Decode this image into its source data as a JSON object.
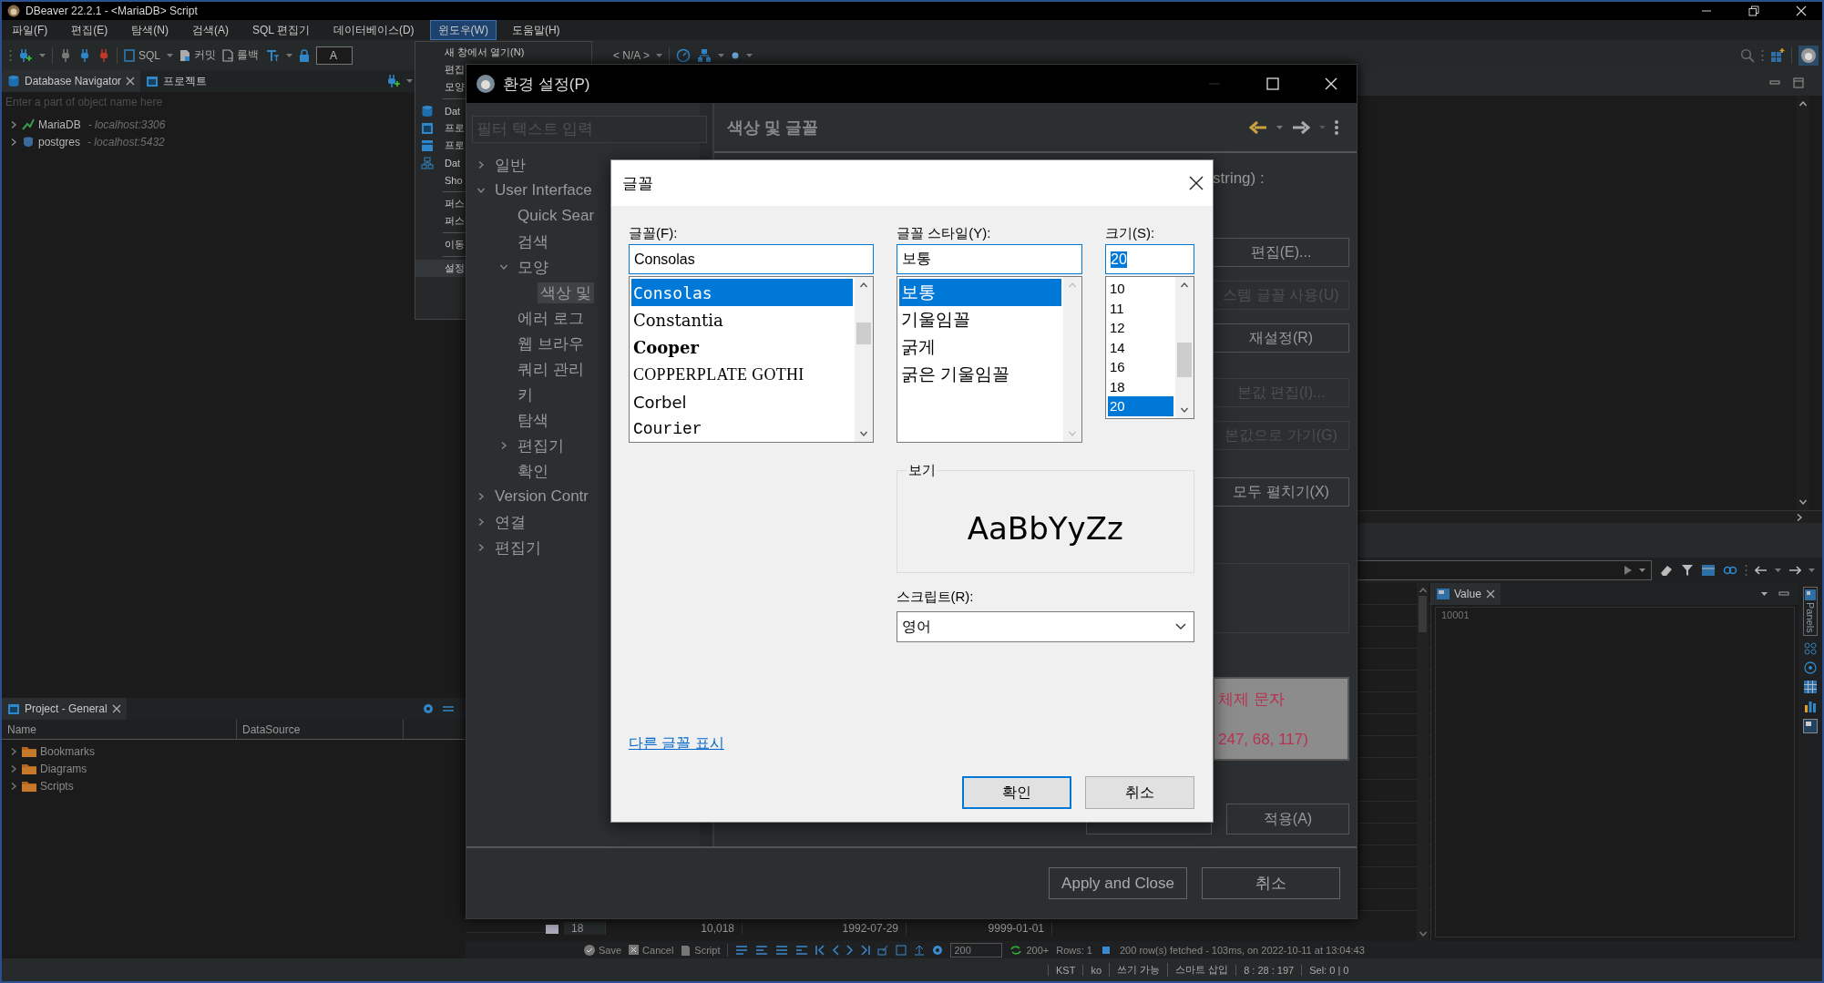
{
  "window": {
    "title": "DBeaver 22.2.1 - <MariaDB> Script"
  },
  "menu_bar": [
    {
      "label": "파일(F)",
      "selected": false
    },
    {
      "label": "편집(E)",
      "selected": false
    },
    {
      "label": "탐색(N)",
      "selected": false
    },
    {
      "label": "검색(A)",
      "selected": false
    },
    {
      "label": "SQL 편집기",
      "selected": false
    },
    {
      "label": "데이터베이스(D)",
      "selected": false
    },
    {
      "label": "윈도우(W)",
      "selected": true
    },
    {
      "label": "도움말(H)",
      "selected": false
    }
  ],
  "toolbar": {
    "sql_label": "SQL",
    "commit_label": "커밋",
    "rollback_label": "롤백",
    "field_value": "A",
    "datasource": "< N/A >"
  },
  "window_menu": {
    "groups": [
      [
        {
          "label": "새 창에서 열기(N)",
          "icon": false,
          "selected": false
        },
        {
          "label": "편집",
          "icon": false,
          "selected": false
        },
        {
          "label": "모양",
          "icon": false,
          "selected": false
        }
      ],
      [
        {
          "label": "Dat",
          "icon": true,
          "selected": false
        },
        {
          "label": "프로",
          "icon": true,
          "selected": false
        },
        {
          "label": "프로",
          "icon": true,
          "selected": false
        },
        {
          "label": "Dat",
          "icon": true,
          "selected": false
        },
        {
          "label": "Sho",
          "icon": false,
          "selected": false
        }
      ],
      [
        {
          "label": "퍼스",
          "icon": false,
          "selected": false
        },
        {
          "label": "퍼스",
          "icon": false,
          "selected": false
        }
      ],
      [
        {
          "label": "이동",
          "icon": false,
          "selected": false
        }
      ],
      [
        {
          "label": "설정",
          "icon": false,
          "selected": true
        }
      ]
    ]
  },
  "navigator": {
    "tabs": [
      {
        "label": "Database Navigator",
        "selected": true
      },
      {
        "label": "프로젝트",
        "selected": false
      }
    ],
    "filter_placeholder": "Enter a part of object name here",
    "connections": [
      {
        "name": "MariaDB",
        "host": "- localhost:3306"
      },
      {
        "name": "postgres",
        "host": "- localhost:5432"
      }
    ]
  },
  "project_panel": {
    "title": "Project - General",
    "columns": [
      "Name",
      "DataSource"
    ],
    "items": [
      "Bookmarks",
      "Diagrams",
      "Scripts"
    ]
  },
  "results": {
    "row": [
      "18",
      "10,018",
      "1992-07-29",
      "9999-01-01"
    ],
    "actions": [
      "Save",
      "Cancel",
      "Script"
    ],
    "fetch_size": "200",
    "more": "200+",
    "rows": "Rows: 1",
    "message": "200 row(s) fetched - 103ms, on 2022-10-11 at 13:04:43"
  },
  "value_panel": {
    "title": "Value",
    "value": "10001"
  },
  "panels_rail": {
    "label": "Panels"
  },
  "status_bar": [
    "KST",
    "ko",
    "쓰기 가능",
    "스마트 삽입",
    "8 : 28 : 197",
    "Sel: 0 | 0"
  ],
  "preferences": {
    "title": "환경 설정(P)",
    "filter_placeholder": "필터 텍스트 입력",
    "tree": [
      {
        "label": "일반",
        "kind": "branch",
        "expanded": false,
        "selected": false
      },
      {
        "label": "User Interface",
        "kind": "branch",
        "expanded": true,
        "selected": false,
        "children": [
          {
            "label": "Quick Sear",
            "kind": "leaf",
            "selected": false
          },
          {
            "label": "검색",
            "kind": "leaf",
            "selected": false
          },
          {
            "label": "모양",
            "kind": "branch",
            "expanded": true,
            "selected": false,
            "children": [
              {
                "label": "색상 및",
                "kind": "leaf",
                "selected": true
              }
            ]
          },
          {
            "label": "에러 로그",
            "kind": "leaf",
            "selected": false
          },
          {
            "label": "웹 브라우",
            "kind": "leaf",
            "selected": false
          },
          {
            "label": "쿼리 관리",
            "kind": "leaf",
            "selected": false
          },
          {
            "label": "키",
            "kind": "leaf",
            "selected": false
          },
          {
            "label": "탐색",
            "kind": "leaf",
            "selected": false
          },
          {
            "label": "편집기",
            "kind": "branch",
            "expanded": false,
            "selected": false
          },
          {
            "label": "확인",
            "kind": "leaf",
            "selected": false
          }
        ]
      },
      {
        "label": "Version Contr",
        "kind": "branch",
        "expanded": false,
        "selected": false
      },
      {
        "label": "연결",
        "kind": "branch",
        "expanded": false,
        "selected": false
      },
      {
        "label": "편집기",
        "kind": "branch",
        "expanded": false,
        "selected": false
      }
    ],
    "page_title": "색상 및 글꼴",
    "page_text": "string) :",
    "side_buttons": [
      {
        "label": "편집(E)...",
        "disabled": false
      },
      {
        "label": "스템 글꼴 사용(U)",
        "disabled": true
      },
      {
        "label": "재설정(R)",
        "disabled": false
      },
      {
        "label": "본값 편집(I)...",
        "disabled": true
      },
      {
        "label": "본값으로 가기(G)",
        "disabled": true
      },
      {
        "label": "모두 펼치기(X)",
        "disabled": false
      }
    ],
    "preview_lines": [
      "체제 문자",
      "247, 68, 117)"
    ],
    "apply_button": "적용(A)",
    "footer_buttons": [
      "Apply and Close",
      "취소"
    ]
  },
  "font_dialog": {
    "title": "글꼴",
    "font": {
      "label": "글꼴(F):",
      "value": "Consolas",
      "options": [
        {
          "label": "Consolas",
          "kind": "mono",
          "selected": true
        },
        {
          "label": "Constantia",
          "kind": "serif",
          "selected": false
        },
        {
          "label": "Cooper",
          "kind": "bold",
          "selected": false
        },
        {
          "label": "COPPERPLATE GOTHI",
          "kind": "wide",
          "selected": false
        },
        {
          "label": "Corbel",
          "kind": "sans",
          "selected": false
        },
        {
          "label": "Courier",
          "kind": "typewriter",
          "selected": false
        }
      ]
    },
    "style": {
      "label": "글꼴 스타일(Y):",
      "value": "보통",
      "options": [
        {
          "label": "보통",
          "selected": true
        },
        {
          "label": "기울임꼴",
          "selected": false
        },
        {
          "label": "굵게",
          "selected": false
        },
        {
          "label": "굵은 기울임꼴",
          "selected": false
        }
      ]
    },
    "size": {
      "label": "크기(S):",
      "value": "20",
      "options": [
        {
          "label": "10",
          "selected": false
        },
        {
          "label": "11",
          "selected": false
        },
        {
          "label": "12",
          "selected": false
        },
        {
          "label": "14",
          "selected": false
        },
        {
          "label": "16",
          "selected": false
        },
        {
          "label": "18",
          "selected": false
        },
        {
          "label": "20",
          "selected": true
        }
      ]
    },
    "preview": {
      "label": "보기",
      "sample": "AaBbYyZz"
    },
    "script": {
      "label": "스크립트(R):",
      "value": "영어"
    },
    "link": "다른 글꼴 표시",
    "buttons": [
      {
        "label": "확인",
        "default": true
      },
      {
        "label": "취소",
        "default": false
      }
    ]
  }
}
